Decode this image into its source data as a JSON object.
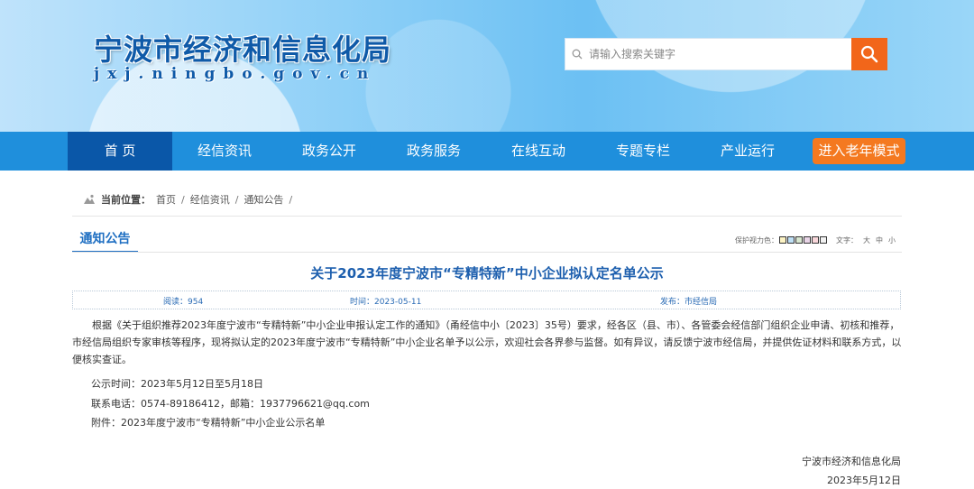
{
  "header": {
    "site_title": "宁波市经济和信息化局",
    "site_domain": "jxj.ningbo.gov.cn",
    "search_placeholder": "请输入搜索关键字"
  },
  "nav": {
    "items": [
      "首 页",
      "经信资讯",
      "政务公开",
      "政务服务",
      "在线互动",
      "专题专栏",
      "产业运行"
    ],
    "active_index": 0,
    "elder_mode": "进入老年模式"
  },
  "breadcrumb": {
    "label": "当前位置：",
    "items": [
      "首页",
      "经信资讯",
      "通知公告"
    ],
    "separator": "/"
  },
  "section": {
    "tab": "通知公告",
    "eye_care_label": "保护视力色：",
    "eye_care_colors": [
      "#fcf3c4",
      "#bfe0f5",
      "#d8e6d0",
      "#e8d4e6",
      "#f8d6da",
      "#f2f2f2"
    ],
    "font_label": "文字：",
    "font_sizes": [
      "大",
      "中",
      "小"
    ]
  },
  "article": {
    "title": "关于2023年度宁波市“专精特新”中小企业拟认定名单公示",
    "reads": "阅读：954",
    "time": "时间：2023-05-11",
    "publisher": "发布：市经信局",
    "paragraph": "根据《关于组织推荐2023年度宁波市“专精特新”中小企业申报认定工作的通知》（甬经信中小〔2023〕35号）要求，经各区（县、市）、各管委会经信部门组织企业申请、初核和推荐，市经信局组织专家审核等程序，现将拟认定的2023年度宁波市“专精特新”中小企业名单予以公示，欢迎社会各界参与监督。如有异议，请反馈宁波市经信局，并提供佐证材料和联系方式，以便核实查证。",
    "period": "公示时间：2023年5月12日至5月18日",
    "contact": "联系电话：0574-89186412，邮箱：1937796621@qq.com",
    "attachment": "附件：2023年度宁波市“专精特新”中小企业公示名单",
    "signature": "宁波市经济和信息化局",
    "date": "2023年5月12日"
  },
  "colors": {
    "nav_bg": "#1f8fdc",
    "nav_active": "#0a57a8",
    "accent_orange": "#f47920",
    "title_blue": "#1d5fae"
  }
}
